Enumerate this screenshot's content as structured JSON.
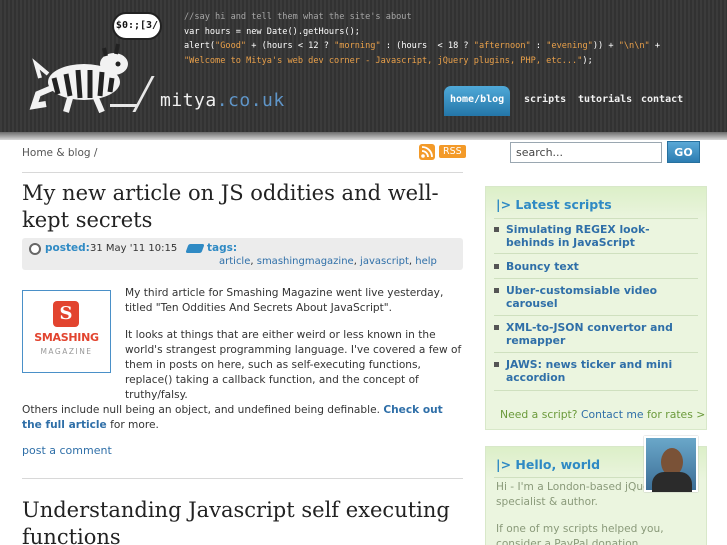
{
  "header": {
    "bubble_text": "$0:;[3/",
    "brand": "mitya",
    "brand_tld": ".co.uk",
    "code_comment": "//say hi and tell them what the site's about",
    "code_line1": "var hours = new Date().getHours();",
    "code_line2_a": "alert(",
    "code_line2_good": "\"Good\"",
    "code_line2_b": " + (hours < 12 ? ",
    "code_line2_morning": "\"morning\"",
    "code_line2_c": " : (hours  < 18 ? ",
    "code_line2_afternoon": "\"afternoon\"",
    "code_line2_d": " : ",
    "code_line2_evening": "\"evening\"",
    "code_line2_e": ")) + ",
    "code_line2_nn": "\"\\n\\n\"",
    "code_line2_f": " +",
    "code_line3": "\"Welcome to Mitya's web dev corner - Javascript, jQuery plugins, PHP, etc...\"",
    "code_line3_end": ");",
    "nav": [
      "home/blog",
      "scripts",
      "tutorials",
      "contact"
    ]
  },
  "breadcrumb": "Home & blog  /",
  "rss": "RSS",
  "search": {
    "value": "search...",
    "button": "GO"
  },
  "article1": {
    "title": "My new article on JS oddities and well-kept secrets",
    "posted_label": "posted:",
    "posted_value": "31 May '11 10:15",
    "tags_label": "tags:",
    "tags": [
      "article",
      "smashingmagazine",
      "javascript",
      "help"
    ],
    "logo_mark": "S",
    "logo_word1": "SMASHING",
    "logo_word2": "MAGAZINE",
    "p1": "My third article for Smashing Magazine went live yesterday, titled \"Ten Oddities And Secrets About JavaScript\".",
    "p2": "It looks at things that are either weird or less known in the world's strangest programming language. I've covered a few of them in posts on here, such as self-executing functions, replace() taking a callback function, and the concept of truthy/falsy.",
    "p3_a": "Others include null being an object, and undefined being definable. ",
    "p3_link": "Check out the full article",
    "p3_b": " for more.",
    "post_comment": "post a comment"
  },
  "article2": {
    "title": "Understanding Javascript self executing functions"
  },
  "sidebar": {
    "latest_title": "|> Latest scripts",
    "scripts": [
      "Simulating REGEX look-behinds in JavaScript",
      "Bouncy text",
      "Uber-customsiable video carousel",
      "XML-to-JSON convertor and remapper",
      "JAWS: news ticker and mini accordion"
    ],
    "need_a": "Need a script? ",
    "need_link": "Contact me",
    "need_b": " for rates >",
    "hello_title": "|> Hello, world",
    "hello_p1": "Hi - I'm a London-based jQuery specialist & author.",
    "hello_p2": "If one of my scripts helped you, consider a PayPal donation"
  }
}
